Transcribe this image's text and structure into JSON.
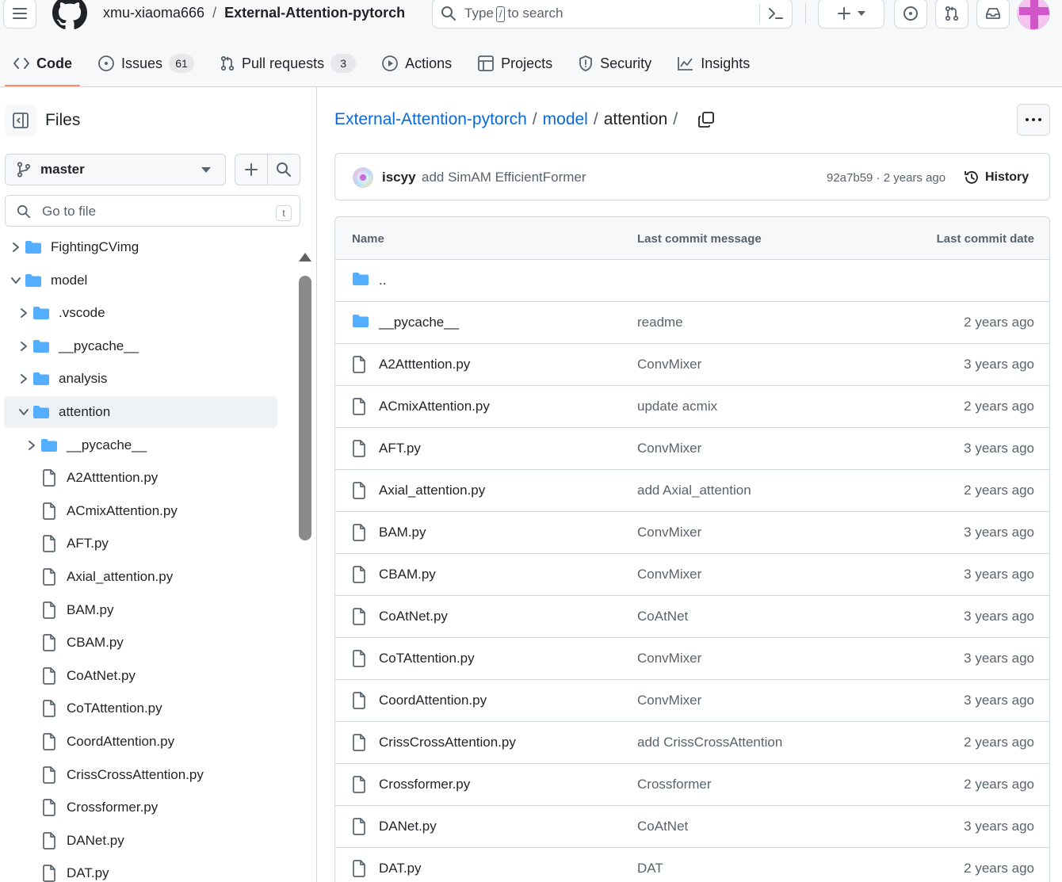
{
  "header": {
    "owner": "xmu-xiaoma666",
    "separator": "/",
    "repo": "External-Attention-pytorch",
    "search": {
      "prefix": "Type",
      "key": "/",
      "suffix": "to search"
    }
  },
  "nav": {
    "tabs": [
      {
        "label": "Code",
        "icon": "code-icon",
        "active": true
      },
      {
        "label": "Issues",
        "icon": "issue-icon",
        "count": "61"
      },
      {
        "label": "Pull requests",
        "icon": "pull-request-icon",
        "count": "3"
      },
      {
        "label": "Actions",
        "icon": "play-icon"
      },
      {
        "label": "Projects",
        "icon": "table-icon"
      },
      {
        "label": "Security",
        "icon": "shield-icon"
      },
      {
        "label": "Insights",
        "icon": "graph-icon"
      }
    ]
  },
  "sidebar": {
    "title": "Files",
    "branch": "master",
    "goto_placeholder": "Go to file",
    "goto_shortcut": "t",
    "tree": [
      {
        "name": "FightingCVimg",
        "type": "folder",
        "depth": 0,
        "expanded": false
      },
      {
        "name": "model",
        "type": "folder",
        "depth": 0,
        "expanded": true
      },
      {
        "name": ".vscode",
        "type": "folder",
        "depth": 1,
        "expanded": false
      },
      {
        "name": "__pycache__",
        "type": "folder",
        "depth": 1,
        "expanded": false
      },
      {
        "name": "analysis",
        "type": "folder",
        "depth": 1,
        "expanded": false
      },
      {
        "name": "attention",
        "type": "folder",
        "depth": 1,
        "expanded": true,
        "selected": true
      },
      {
        "name": "__pycache__",
        "type": "folder",
        "depth": 2,
        "expanded": false
      },
      {
        "name": "A2Atttention.py",
        "type": "file",
        "depth": 2
      },
      {
        "name": "ACmixAttention.py",
        "type": "file",
        "depth": 2
      },
      {
        "name": "AFT.py",
        "type": "file",
        "depth": 2
      },
      {
        "name": "Axial_attention.py",
        "type": "file",
        "depth": 2
      },
      {
        "name": "BAM.py",
        "type": "file",
        "depth": 2
      },
      {
        "name": "CBAM.py",
        "type": "file",
        "depth": 2
      },
      {
        "name": "CoAtNet.py",
        "type": "file",
        "depth": 2
      },
      {
        "name": "CoTAttention.py",
        "type": "file",
        "depth": 2
      },
      {
        "name": "CoordAttention.py",
        "type": "file",
        "depth": 2
      },
      {
        "name": "CrissCrossAttention.py",
        "type": "file",
        "depth": 2
      },
      {
        "name": "Crossformer.py",
        "type": "file",
        "depth": 2
      },
      {
        "name": "DANet.py",
        "type": "file",
        "depth": 2
      },
      {
        "name": "DAT.py",
        "type": "file",
        "depth": 2
      }
    ]
  },
  "main": {
    "breadcrumb": [
      {
        "label": "External-Attention-pytorch",
        "link": true
      },
      {
        "label": "model",
        "link": true
      },
      {
        "label": "attention",
        "link": false
      }
    ],
    "breadcrumb_sep": "/",
    "commit": {
      "author": "iscyy",
      "message": "add SimAM EfficientFormer",
      "meta": "92a7b59 · 2 years ago",
      "history_label": "History"
    },
    "table": {
      "headers": {
        "name": "Name",
        "message": "Last commit message",
        "date": "Last commit date"
      },
      "rows": [
        {
          "name": "..",
          "type": "folder",
          "message": "",
          "date": ""
        },
        {
          "name": "__pycache__",
          "type": "folder",
          "message": "readme",
          "date": "2 years ago"
        },
        {
          "name": "A2Atttention.py",
          "type": "file",
          "message": "ConvMixer",
          "date": "3 years ago"
        },
        {
          "name": "ACmixAttention.py",
          "type": "file",
          "message": "update acmix",
          "date": "2 years ago"
        },
        {
          "name": "AFT.py",
          "type": "file",
          "message": "ConvMixer",
          "date": "3 years ago"
        },
        {
          "name": "Axial_attention.py",
          "type": "file",
          "message": "add Axial_attention",
          "date": "2 years ago"
        },
        {
          "name": "BAM.py",
          "type": "file",
          "message": "ConvMixer",
          "date": "3 years ago"
        },
        {
          "name": "CBAM.py",
          "type": "file",
          "message": "ConvMixer",
          "date": "3 years ago"
        },
        {
          "name": "CoAtNet.py",
          "type": "file",
          "message": "CoAtNet",
          "date": "3 years ago"
        },
        {
          "name": "CoTAttention.py",
          "type": "file",
          "message": "ConvMixer",
          "date": "3 years ago"
        },
        {
          "name": "CoordAttention.py",
          "type": "file",
          "message": "ConvMixer",
          "date": "3 years ago"
        },
        {
          "name": "CrissCrossAttention.py",
          "type": "file",
          "message": "add CrissCrossAttention",
          "date": "2 years ago"
        },
        {
          "name": "Crossformer.py",
          "type": "file",
          "message": "Crossformer",
          "date": "2 years ago"
        },
        {
          "name": "DANet.py",
          "type": "file",
          "message": "CoAtNet",
          "date": "3 years ago"
        },
        {
          "name": "DAT.py",
          "type": "file",
          "message": "DAT",
          "date": "2 years ago"
        }
      ]
    }
  },
  "colors": {
    "accent": "#0969da",
    "folder": "#54aeff",
    "tab_underline": "#fd8c73",
    "muted": "#59636e"
  }
}
